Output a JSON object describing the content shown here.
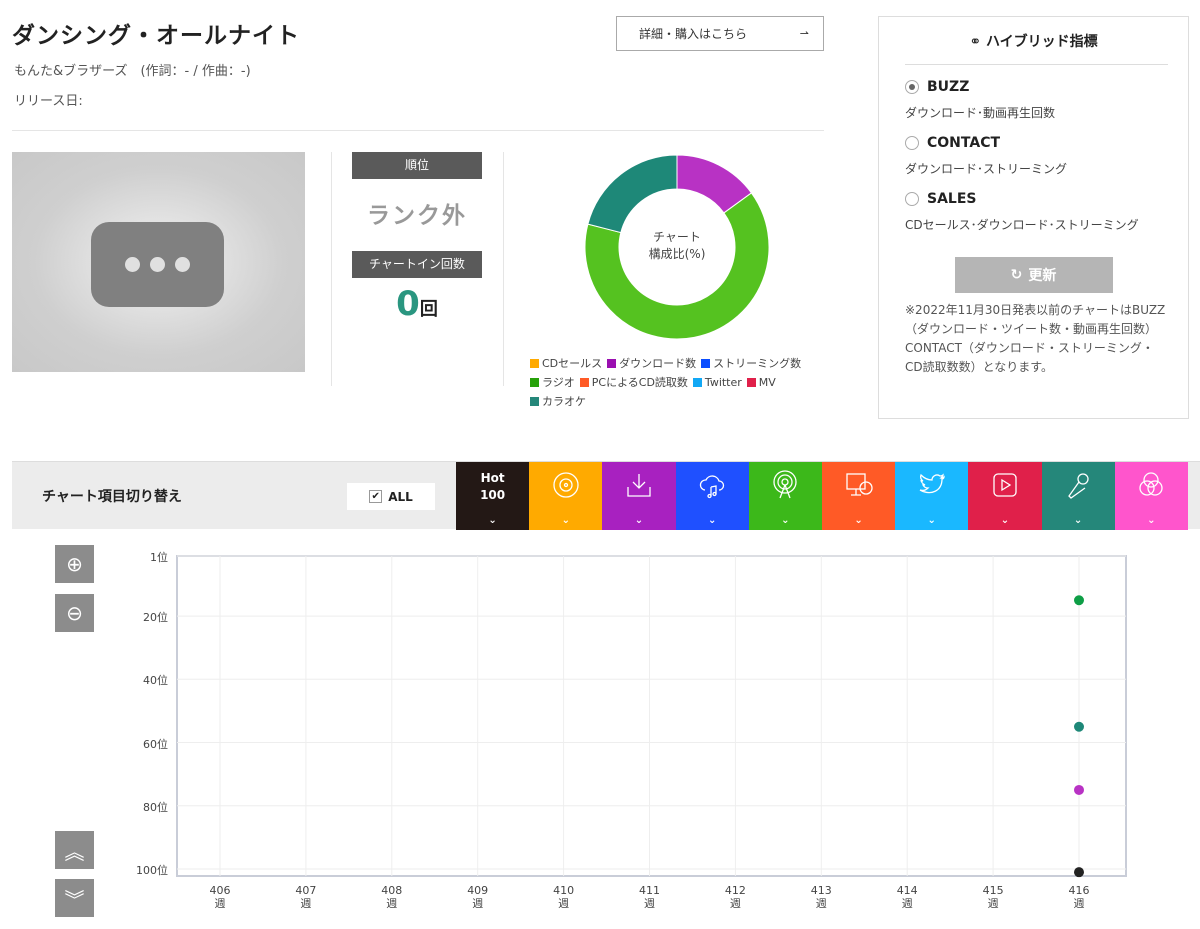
{
  "song": {
    "title": "ダンシング・オールナイト",
    "artist": "もんた&ブラザーズ　(作詞：- / 作曲：-)",
    "release": "リリース日:"
  },
  "detail_button": "詳細・購入はこちら",
  "rank": {
    "label": "順位",
    "value": "ランク外"
  },
  "chart_in": {
    "label": "チャートイン回数",
    "value": "0",
    "unit": "回"
  },
  "donut": {
    "center_line1": "チャート",
    "center_line2": "構成比(%)",
    "legend": [
      {
        "label": "CDセールス",
        "color": "#ffaa00"
      },
      {
        "label": "ダウンロード数",
        "color": "#9a0fb0"
      },
      {
        "label": "ストリーミング数",
        "color": "#0a4dff"
      },
      {
        "label": "ラジオ",
        "color": "#27a10a"
      },
      {
        "label": "PCによるCD読取数",
        "color": "#ff5a26"
      },
      {
        "label": "Twitter",
        "color": "#12a8f5"
      },
      {
        "label": "MV",
        "color": "#e0204a"
      },
      {
        "label": "カラオケ",
        "color": "#25877a"
      }
    ],
    "slices": [
      {
        "label": "ダウンロード数",
        "value": 15,
        "color": "#b832c4"
      },
      {
        "label": "ラジオ",
        "value": 64,
        "color": "#55c220"
      },
      {
        "label": "カラオケ",
        "value": 21,
        "color": "#1e8878"
      }
    ]
  },
  "hybrid": {
    "title": "ハイブリッド指標",
    "options": [
      {
        "label": "BUZZ",
        "desc": "ダウンロード･動画再生回数",
        "selected": true
      },
      {
        "label": "CONTACT",
        "desc": "ダウンロード･ストリーミング",
        "selected": false
      },
      {
        "label": "SALES",
        "desc": "CDセールス･ダウンロード･ストリーミング",
        "selected": false
      }
    ],
    "refresh": "更新",
    "note": "※2022年11月30日発表以前のチャートはBUZZ（ダウンロード・ツイート数・動画再生回数）CONTACT（ダウンロード・ストリーミング・CD読取数数）となります。"
  },
  "switcher": {
    "label": "チャート項目切り替え",
    "all": "ALL",
    "tabs": [
      {
        "name": "hot100",
        "line1": "Hot",
        "line2": "100",
        "color": "#231815"
      },
      {
        "name": "cd-sales",
        "color": "#ffaa00"
      },
      {
        "name": "download",
        "color": "#a821c0"
      },
      {
        "name": "streaming",
        "color": "#1f50ff"
      },
      {
        "name": "radio",
        "color": "#3cb81a"
      },
      {
        "name": "pc-cd-read",
        "color": "#ff5a26"
      },
      {
        "name": "twitter",
        "color": "#1ab8ff"
      },
      {
        "name": "mv",
        "color": "#e0204a"
      },
      {
        "name": "karaoke",
        "color": "#25877a"
      },
      {
        "name": "hybrid",
        "color": "#ff55cc"
      }
    ]
  },
  "chart_data": {
    "type": "scatter",
    "xlabel": "",
    "ylabel": "",
    "x": [
      406,
      407,
      408,
      409,
      410,
      411,
      412,
      413,
      414,
      415,
      416
    ],
    "x_tick_labels": [
      "406",
      "407",
      "408",
      "409",
      "410",
      "411",
      "412",
      "413",
      "414",
      "415",
      "416"
    ],
    "x_unit": "週",
    "y_tick_labels": [
      "1位",
      "20位",
      "40位",
      "60位",
      "80位",
      "100位"
    ],
    "y_ticks": [
      1,
      20,
      40,
      60,
      80,
      100
    ],
    "ylim": [
      1,
      100
    ],
    "y_inverted": true,
    "grid": true,
    "series": [
      {
        "name": "ラジオ",
        "color": "#0e9e46",
        "points": [
          [
            416,
            15
          ]
        ]
      },
      {
        "name": "カラオケ",
        "color": "#1e8878",
        "points": [
          [
            416,
            55
          ]
        ]
      },
      {
        "name": "ダウンロード数",
        "color": "#b832c4",
        "points": [
          [
            416,
            75
          ]
        ]
      },
      {
        "name": "Hot 100",
        "color": "#222222",
        "points": [
          [
            416,
            101
          ]
        ]
      }
    ]
  }
}
